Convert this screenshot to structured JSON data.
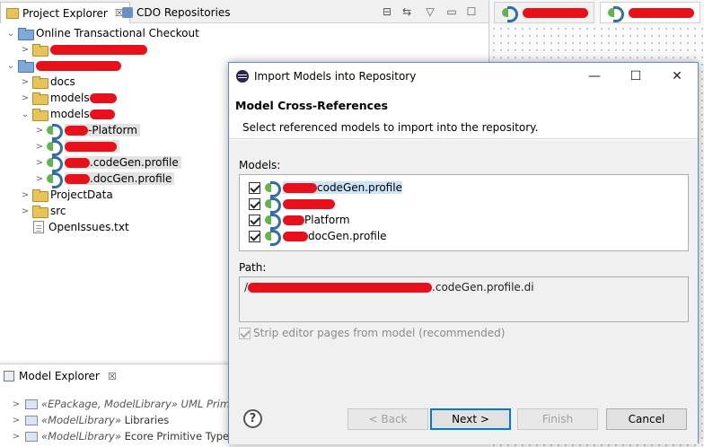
{
  "left_view": {
    "tabs": [
      {
        "label": "Project Explorer",
        "active": true,
        "close": "☒"
      },
      {
        "label": "CDO Repositories",
        "active": false
      }
    ],
    "tree": [
      {
        "label": "Online Transactional Checkout",
        "level": 0,
        "icon": "project-folder-icon",
        "expanded": true
      },
      {
        "label": "",
        "level": 1,
        "icon": "folder-icon",
        "expanded": false,
        "redacted": true
      },
      {
        "label": "",
        "level": 0,
        "icon": "project-folder-icon",
        "expanded": true,
        "redacted": true
      },
      {
        "label": "docs",
        "level": 1,
        "icon": "folder-icon",
        "expanded": false
      },
      {
        "label": "models",
        "level": 1,
        "icon": "folder-icon",
        "expanded": false,
        "redacted_suffix": true
      },
      {
        "label": "models",
        "level": 1,
        "icon": "folder-icon",
        "expanded": true,
        "redacted_suffix": true
      },
      {
        "label": "-Platform",
        "level": 2,
        "icon": "model-icon",
        "expanded": false,
        "redacted_prefix": true,
        "selected": true
      },
      {
        "label": "",
        "level": 2,
        "icon": "model-icon",
        "expanded": false,
        "redacted": true,
        "selected": true
      },
      {
        "label": ".codeGen.profile",
        "level": 2,
        "icon": "model-icon",
        "expanded": false,
        "redacted_prefix": true,
        "selected": true
      },
      {
        "label": ".docGen.profile",
        "level": 2,
        "icon": "model-icon",
        "expanded": false,
        "redacted_prefix": true,
        "selected": true
      },
      {
        "label": "ProjectData",
        "level": 1,
        "icon": "folder-icon",
        "expanded": false
      },
      {
        "label": "src",
        "level": 1,
        "icon": "folder-icon",
        "expanded": false
      },
      {
        "label": "OpenIssues.txt",
        "level": 1,
        "icon": "text-file-icon",
        "leaf": true
      }
    ]
  },
  "model_explorer": {
    "title": "Model Explorer",
    "close": "☒",
    "rows": [
      {
        "stereo": "«EPackage, ModelLibrary» UML Primitiv"
      },
      {
        "stereo": "«ModelLibrary»",
        "name": "Libraries"
      },
      {
        "stereo": "«ModelLibrary»",
        "name": "Ecore Primitive Types"
      }
    ]
  },
  "dialog": {
    "title": "Import Models into Repository",
    "window_buttons": {
      "minimize": "—",
      "maximize": "☐",
      "close": "✕"
    },
    "header": "Model Cross-References",
    "description": "Select referenced models to import into the repository.",
    "models_label": "Models:",
    "models": [
      {
        "label": "codeGen.profile",
        "checked": true,
        "highlighted": true
      },
      {
        "label": "",
        "checked": true
      },
      {
        "label": "Platform",
        "checked": true
      },
      {
        "label": "docGen.profile",
        "checked": true
      }
    ],
    "path_label": "Path:",
    "path_prefix": "/",
    "path_suffix": ".codeGen.profile.di",
    "strip_label": "Strip editor pages from model (recommended)",
    "strip_checked": true,
    "help": "?",
    "buttons": {
      "back": "< Back",
      "next": "Next >",
      "finish": "Finish",
      "cancel": "Cancel"
    }
  },
  "colors": {
    "redaction": "#e8101a",
    "accent": "#0078d7",
    "selection": "#cce4f7"
  }
}
